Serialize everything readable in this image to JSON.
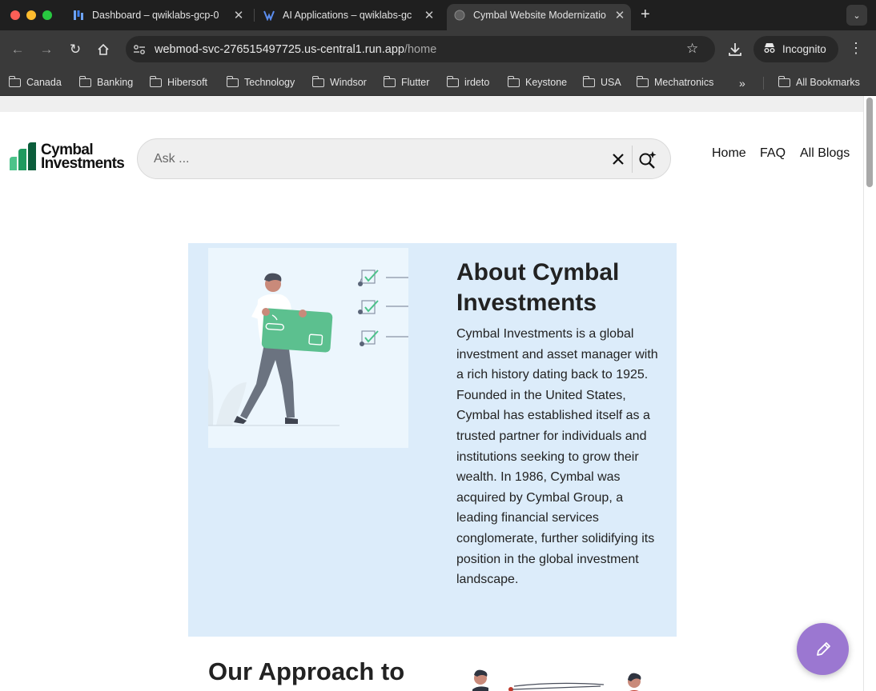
{
  "browser": {
    "tabs": [
      {
        "title": "Dashboard – qwiklabs-gcp-0",
        "active": false,
        "favicon": "dashboard-favicon"
      },
      {
        "title": "AI Applications – qwiklabs-gc",
        "active": false,
        "favicon": "ai-applications-favicon"
      },
      {
        "title": "Cymbal Website Modernizatio",
        "active": true,
        "favicon": "globe-favicon"
      }
    ],
    "new_tab": "+",
    "url": {
      "host": "webmod-svc-276515497725.us-central1.run.app",
      "path": "/home"
    },
    "profile_label": "Incognito",
    "bookmarks": [
      "Canada",
      "Banking",
      "Hibersoft",
      "Technology",
      "Windsor",
      "Flutter",
      "irdeto",
      "Keystone",
      "USA",
      "Mechatronics"
    ],
    "bookmarks_overflow": "»",
    "all_bookmarks": "All Bookmarks"
  },
  "site": {
    "logo": {
      "line1": "Cymbal",
      "line2": "Investments"
    },
    "search": {
      "placeholder": "Ask ...",
      "value": ""
    },
    "nav": [
      {
        "label": "Home"
      },
      {
        "label": "FAQ"
      },
      {
        "label": "All Blogs"
      }
    ],
    "about": {
      "title": "About Cymbal Investments",
      "body": "Cymbal Investments is a global investment and asset manager with a rich history dating back to 1925. Founded in the United States, Cymbal has established itself as a trusted partner for individuals and institutions seeking to grow their wealth. In 1986, Cymbal was acquired by Cymbal Group, a leading financial services conglomerate, further solidifying its position in the global investment landscape."
    },
    "approach": {
      "title": "Our Approach to"
    }
  },
  "colors": {
    "brand_dark_green": "#0b5d3b",
    "brand_light_green": "#4cc38a",
    "about_bg": "#dcecfa",
    "fab": "#9b77d1"
  }
}
